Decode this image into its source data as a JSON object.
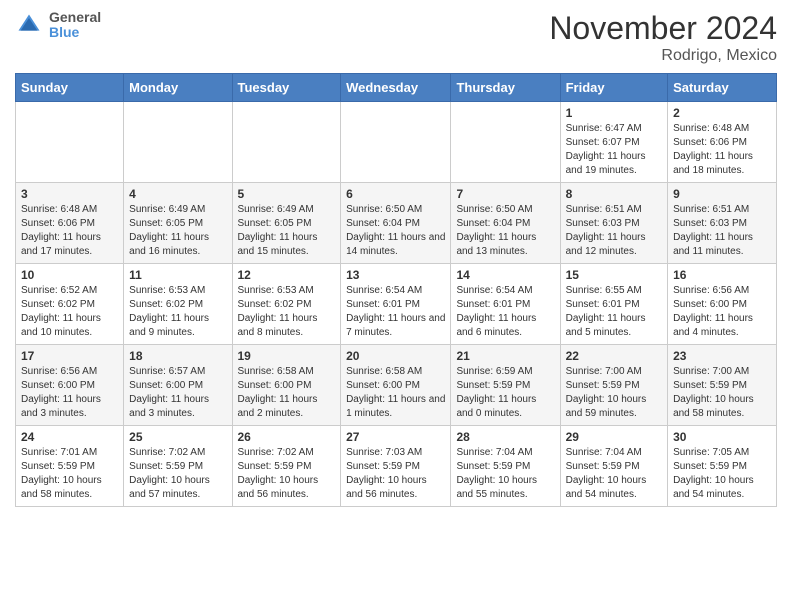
{
  "header": {
    "logo_line1": "General",
    "logo_line2": "Blue",
    "month_title": "November 2024",
    "location": "Rodrigo, Mexico"
  },
  "weekdays": [
    "Sunday",
    "Monday",
    "Tuesday",
    "Wednesday",
    "Thursday",
    "Friday",
    "Saturday"
  ],
  "weeks": [
    [
      {
        "day": "",
        "info": ""
      },
      {
        "day": "",
        "info": ""
      },
      {
        "day": "",
        "info": ""
      },
      {
        "day": "",
        "info": ""
      },
      {
        "day": "",
        "info": ""
      },
      {
        "day": "1",
        "info": "Sunrise: 6:47 AM\nSunset: 6:07 PM\nDaylight: 11 hours and 19 minutes."
      },
      {
        "day": "2",
        "info": "Sunrise: 6:48 AM\nSunset: 6:06 PM\nDaylight: 11 hours and 18 minutes."
      }
    ],
    [
      {
        "day": "3",
        "info": "Sunrise: 6:48 AM\nSunset: 6:06 PM\nDaylight: 11 hours and 17 minutes."
      },
      {
        "day": "4",
        "info": "Sunrise: 6:49 AM\nSunset: 6:05 PM\nDaylight: 11 hours and 16 minutes."
      },
      {
        "day": "5",
        "info": "Sunrise: 6:49 AM\nSunset: 6:05 PM\nDaylight: 11 hours and 15 minutes."
      },
      {
        "day": "6",
        "info": "Sunrise: 6:50 AM\nSunset: 6:04 PM\nDaylight: 11 hours and 14 minutes."
      },
      {
        "day": "7",
        "info": "Sunrise: 6:50 AM\nSunset: 6:04 PM\nDaylight: 11 hours and 13 minutes."
      },
      {
        "day": "8",
        "info": "Sunrise: 6:51 AM\nSunset: 6:03 PM\nDaylight: 11 hours and 12 minutes."
      },
      {
        "day": "9",
        "info": "Sunrise: 6:51 AM\nSunset: 6:03 PM\nDaylight: 11 hours and 11 minutes."
      }
    ],
    [
      {
        "day": "10",
        "info": "Sunrise: 6:52 AM\nSunset: 6:02 PM\nDaylight: 11 hours and 10 minutes."
      },
      {
        "day": "11",
        "info": "Sunrise: 6:53 AM\nSunset: 6:02 PM\nDaylight: 11 hours and 9 minutes."
      },
      {
        "day": "12",
        "info": "Sunrise: 6:53 AM\nSunset: 6:02 PM\nDaylight: 11 hours and 8 minutes."
      },
      {
        "day": "13",
        "info": "Sunrise: 6:54 AM\nSunset: 6:01 PM\nDaylight: 11 hours and 7 minutes."
      },
      {
        "day": "14",
        "info": "Sunrise: 6:54 AM\nSunset: 6:01 PM\nDaylight: 11 hours and 6 minutes."
      },
      {
        "day": "15",
        "info": "Sunrise: 6:55 AM\nSunset: 6:01 PM\nDaylight: 11 hours and 5 minutes."
      },
      {
        "day": "16",
        "info": "Sunrise: 6:56 AM\nSunset: 6:00 PM\nDaylight: 11 hours and 4 minutes."
      }
    ],
    [
      {
        "day": "17",
        "info": "Sunrise: 6:56 AM\nSunset: 6:00 PM\nDaylight: 11 hours and 3 minutes."
      },
      {
        "day": "18",
        "info": "Sunrise: 6:57 AM\nSunset: 6:00 PM\nDaylight: 11 hours and 3 minutes."
      },
      {
        "day": "19",
        "info": "Sunrise: 6:58 AM\nSunset: 6:00 PM\nDaylight: 11 hours and 2 minutes."
      },
      {
        "day": "20",
        "info": "Sunrise: 6:58 AM\nSunset: 6:00 PM\nDaylight: 11 hours and 1 minutes."
      },
      {
        "day": "21",
        "info": "Sunrise: 6:59 AM\nSunset: 5:59 PM\nDaylight: 11 hours and 0 minutes."
      },
      {
        "day": "22",
        "info": "Sunrise: 7:00 AM\nSunset: 5:59 PM\nDaylight: 10 hours and 59 minutes."
      },
      {
        "day": "23",
        "info": "Sunrise: 7:00 AM\nSunset: 5:59 PM\nDaylight: 10 hours and 58 minutes."
      }
    ],
    [
      {
        "day": "24",
        "info": "Sunrise: 7:01 AM\nSunset: 5:59 PM\nDaylight: 10 hours and 58 minutes."
      },
      {
        "day": "25",
        "info": "Sunrise: 7:02 AM\nSunset: 5:59 PM\nDaylight: 10 hours and 57 minutes."
      },
      {
        "day": "26",
        "info": "Sunrise: 7:02 AM\nSunset: 5:59 PM\nDaylight: 10 hours and 56 minutes."
      },
      {
        "day": "27",
        "info": "Sunrise: 7:03 AM\nSunset: 5:59 PM\nDaylight: 10 hours and 56 minutes."
      },
      {
        "day": "28",
        "info": "Sunrise: 7:04 AM\nSunset: 5:59 PM\nDaylight: 10 hours and 55 minutes."
      },
      {
        "day": "29",
        "info": "Sunrise: 7:04 AM\nSunset: 5:59 PM\nDaylight: 10 hours and 54 minutes."
      },
      {
        "day": "30",
        "info": "Sunrise: 7:05 AM\nSunset: 5:59 PM\nDaylight: 10 hours and 54 minutes."
      }
    ]
  ]
}
